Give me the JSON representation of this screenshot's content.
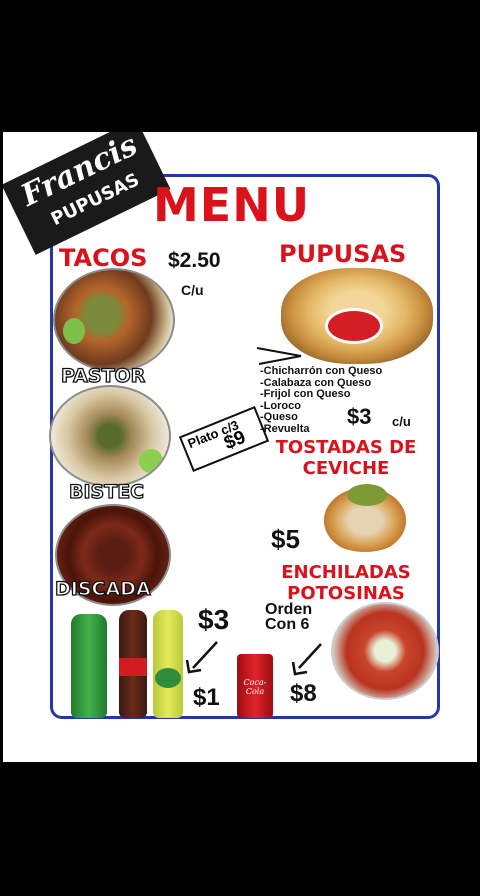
{
  "logo": {
    "script": "Francis",
    "block": "PUPUSAS"
  },
  "menu": {
    "title": "MENU",
    "tacos": {
      "label": "TACOS",
      "price": "$2.50",
      "unit": "C/u",
      "plate_text": "Plato c/3",
      "plate_price": "$9",
      "items": [
        "PASTOR",
        "BISTEC",
        "DISCADA"
      ]
    },
    "pupusas": {
      "label": "PUPUSAS",
      "fillings": [
        "-Chicharrón con Queso",
        "-Calabaza con Queso",
        "-Frijol con Queso",
        "-Loroco",
        "-Queso",
        "-Revuelta"
      ],
      "price": "$3",
      "unit": "c/u"
    },
    "tostadas": {
      "label_line1": "TOSTADAS DE",
      "label_line2": "CEVICHE",
      "price": "$5"
    },
    "enchiladas": {
      "label_line1": "ENCHILADAS",
      "label_line2": "POTOSINAS",
      "order_line1": "Orden",
      "order_line2": "Con 6",
      "price": "$8"
    },
    "drinks": {
      "bottle_price": "$3",
      "can_price": "$1",
      "can_brand": "Coca-Cola"
    }
  },
  "colors": {
    "title_red": "#d9121b",
    "frame_blue": "#2337a8",
    "page_bg": "#000000"
  }
}
